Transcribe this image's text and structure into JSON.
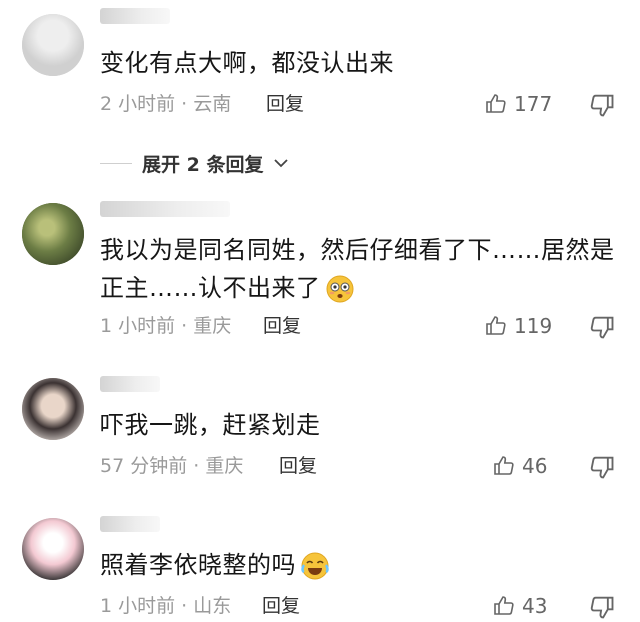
{
  "comments": [
    {
      "text_lines": [
        "变化有点大啊，都没认出来"
      ],
      "meta": "2 小时前 · 云南",
      "reply_label": "回复",
      "likes": "177"
    },
    {
      "text_lines": [
        "我以为是同名同姓，然后仔细看了下……居然是",
        "正主……认不出来了"
      ],
      "meta": "1 小时前 · 重庆",
      "reply_label": "回复",
      "likes": "119"
    },
    {
      "text_lines": [
        "吓我一跳，赶紧划走"
      ],
      "meta": "57 分钟前 · 重庆",
      "reply_label": "回复",
      "likes": "46"
    },
    {
      "text_lines": [
        "照着李依晓整的吗"
      ],
      "meta": "1 小时前 · 山东",
      "reply_label": "回复",
      "likes": "43"
    }
  ],
  "expand_replies": "展开 2 条回复",
  "icons": {
    "like": "thumbs-up-icon",
    "dislike": "thumbs-down-icon",
    "expand": "chevron-down-icon",
    "emoji_surprised": "flushed-face-emoji",
    "emoji_crying": "crying-laughing-emoji"
  },
  "colors": {
    "meta": "#9a9a9a",
    "text": "#161616",
    "background": "#ffffff"
  }
}
